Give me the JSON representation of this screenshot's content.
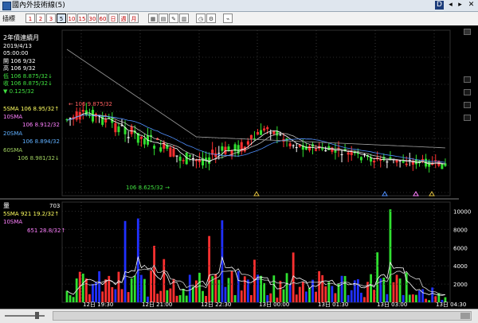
{
  "window": {
    "title": "國內外技術線(5)",
    "btn_restore": "D",
    "btn_prev": "◂",
    "btn_next": "▸",
    "btn_close": "✕"
  },
  "toolbar": {
    "label": "插標",
    "periods": [
      "1",
      "2",
      "3",
      "5",
      "10",
      "15",
      "30",
      "60",
      "日",
      "週",
      "月"
    ],
    "selected_period": "5",
    "tools": [
      "layout-icon",
      "grid-icon",
      "edit-icon",
      "table-icon",
      "clock-icon",
      "settings-icon",
      "draw-icon"
    ]
  },
  "info": {
    "title": "2年債連續月",
    "date": "2019/4/13",
    "time": "05:00:00",
    "open": "開 106 9/32",
    "high": "高 106 9/32",
    "low": "低 106 8.875/32↓",
    "close": "收 106 8.875/32↓",
    "change": "▼ 0.125/32"
  },
  "ma": {
    "ma5": "5SMA  106 8.95/32↑",
    "ma10_label": "10SMA",
    "ma10_value": "106 8.912/32",
    "ma20": "20SMA",
    "ma20_value": "106 8.894/32",
    "ma60": "60SMA",
    "ma60_value": "106 8.981/32↓"
  },
  "annotations": {
    "high_marker": "← 106 9.875/32",
    "low_marker": "106 8.625/32 →"
  },
  "volume": {
    "label": "量",
    "value": "703",
    "ma5": "5SMA  921 19.2/32↑",
    "ma10_label": "10SMA",
    "ma10_value": "651 28.8/32↑",
    "y_ticks": [
      "10000",
      "8000",
      "6000",
      "4000",
      "2000"
    ]
  },
  "x_ticks": [
    "12日 19:30",
    "12日 21:00",
    "12日 22:30",
    "13日 00:00",
    "13日 01:30",
    "13日 03:00",
    "13日 04:30"
  ],
  "colors": {
    "up": "#ff3030",
    "down": "#30e030",
    "doji": "#ffffff",
    "vol_blue": "#2030ff",
    "ma5": "#ffffff",
    "ma10": "#c0c0c0",
    "ma20": "#5090ff",
    "ma60": "#909090",
    "price_label_red": "#ff6060",
    "price_label_green": "#40e040"
  }
}
